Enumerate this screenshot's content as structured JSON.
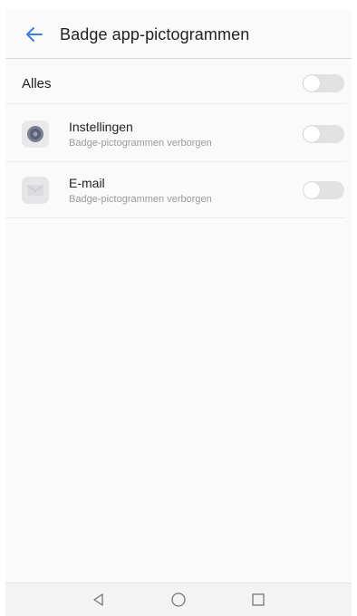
{
  "header": {
    "back_icon": "arrow-left-icon",
    "title": "Badge app-pictogrammen"
  },
  "all_row": {
    "label": "Alles",
    "toggle_on": false
  },
  "apps": [
    {
      "name": "Instellingen",
      "subtitle": "Badge-pictogrammen verborgen",
      "icon": "settings-app-icon",
      "toggle_on": false
    },
    {
      "name": "E-mail",
      "subtitle": "Badge-pictogrammen verborgen",
      "icon": "email-app-icon",
      "toggle_on": false
    }
  ],
  "navbar": {
    "back": "nav-back-icon",
    "home": "nav-home-icon",
    "recents": "nav-recents-icon"
  },
  "colors": {
    "accent": "#3f7fd9",
    "toggle_off": "#e2e2e2",
    "subtitle": "#9a9a9a"
  }
}
